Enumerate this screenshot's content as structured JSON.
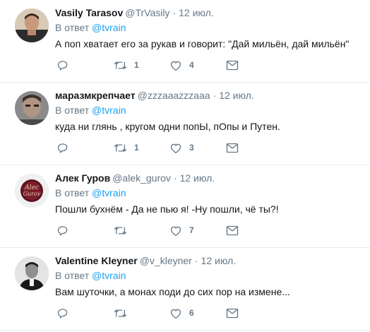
{
  "reply_prefix": "В ответ",
  "tweets": [
    {
      "name": "Vasily Tarasov",
      "handle": "@TrVasily",
      "time": "12 июл.",
      "reply_to": "@tvrain",
      "text": "А поп хватает его за рукав и говорит: \"Дай мильён, дай мильён\"",
      "retweets": "1",
      "likes": "4"
    },
    {
      "name": "маразмкрепчает",
      "handle": "@zzzaaazzzaaa",
      "time": "12 июл.",
      "reply_to": "@tvrain",
      "text": "куда ни глянь , кругом одни попЫ,  пОпы   и Путен.",
      "retweets": "1",
      "likes": "3"
    },
    {
      "name": "Алек Гуров",
      "handle": "@alek_gurov",
      "time": "12 июл.",
      "reply_to": "@tvrain",
      "text": "Пошли бухнём - Да не пью я!  -Ну пошли, чё ты?!",
      "retweets": "",
      "likes": "7"
    },
    {
      "name": "Valentine Kleyner",
      "handle": "@v_kleyner",
      "time": "12 июл.",
      "reply_to": "@tvrain",
      "text": "Вам шуточки, а монах поди до сих пор на измене...",
      "retweets": "",
      "likes": "6"
    }
  ],
  "avatar_logo_text": "Alec Gurov",
  "colors": {
    "text": "#14171a",
    "secondary": "#657786",
    "link": "#1da1f2",
    "divider": "#e6ecf0"
  },
  "icons": [
    "reply-icon",
    "retweet-icon",
    "like-icon",
    "message-icon"
  ]
}
